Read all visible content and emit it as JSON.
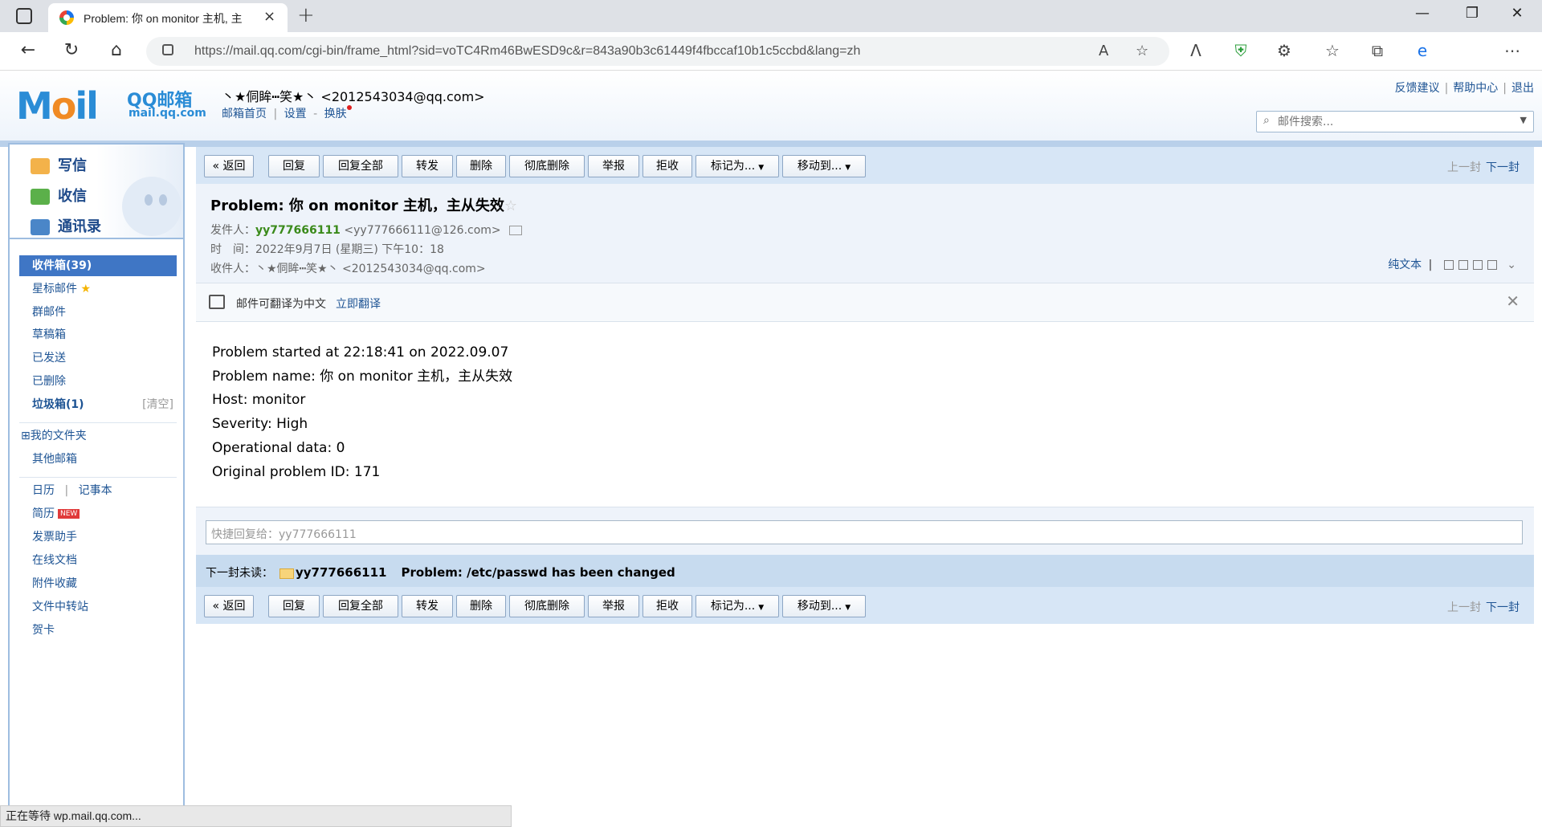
{
  "browser": {
    "tab_title": "Problem: 你 on monitor 主机, 主",
    "url": "https://mail.qq.com/cgi-bin/frame_html?sid=voTC4Rm46BwESD9c&r=843a90b3c61449f4fbccaf10b1c5ccbd&lang=zh",
    "status_text": "正在等待 wp.mail.qq.com..."
  },
  "header": {
    "logo_text": "M",
    "logo_o": "o",
    "logo_rest": "il",
    "logo_cn": "QQ邮箱",
    "logo_domain": "mail.qq.com",
    "account": "丶★侗眸┅笑★丶 <2012543034@qq.com>",
    "link_home": "邮箱首页",
    "link_settings": "设置",
    "link_skin": "换肤",
    "link_feedback": "反馈建议",
    "link_help": "帮助中心",
    "link_logout": "退出",
    "search_placeholder": "邮件搜索..."
  },
  "sidebar": {
    "compose": "写信",
    "receive": "收信",
    "contacts": "通讯录",
    "folders": [
      {
        "label": "收件箱(39)"
      },
      {
        "label": "星标邮件"
      },
      {
        "label": "群邮件"
      },
      {
        "label": "草稿箱"
      },
      {
        "label": "已发送"
      },
      {
        "label": "已删除"
      },
      {
        "label": "垃圾箱(1)",
        "aux": "[清空]"
      }
    ],
    "my_folders": "⊞我的文件夹",
    "other_mail": "其他邮箱",
    "calendar": "日历",
    "notepad": "记事本",
    "resume": "简历",
    "new_badge": "NEW",
    "invoice": "发票助手",
    "docs": "在线文档",
    "attach": "附件收藏",
    "transfer": "文件中转站",
    "cards": "贺卡"
  },
  "toolbar": {
    "back": "« 返回",
    "reply": "回复",
    "reply_all": "回复全部",
    "forward": "转发",
    "delete": "删除",
    "delete_perm": "彻底删除",
    "report": "举报",
    "reject": "拒收",
    "mark_as": "标记为...",
    "move_to": "移动到...",
    "prev": "上一封",
    "next": "下一封"
  },
  "mail": {
    "subject": "Problem: 你 on monitor 主机，主从失效",
    "from_label": "发件人：",
    "from_name": "yy777666111",
    "from_addr": "<yy777666111@126.com>",
    "time_label": "时　间：",
    "time_value": "2022年9月7日 (星期三) 下午10：18",
    "to_label": "收件人：",
    "to_value": "丶★侗眸┅笑★丶 <2012543034@qq.com>",
    "plain_text": "纯文本",
    "translate_note": "邮件可翻译为中文",
    "translate_link": "立即翻译",
    "body_lines": [
      "Problem started at 22:18:41 on 2022.09.07",
      "Problem name: 你 on monitor 主机，主从失效",
      "Host: monitor",
      "Severity: High",
      "Operational data: 0",
      "Original problem ID: 171"
    ],
    "quick_reply_placeholder": "快捷回复给：yy777666111",
    "next_unread_label": "下一封未读：",
    "next_unread_from": "yy777666111",
    "next_unread_subject": "Problem: /etc/passwd has been changed"
  }
}
